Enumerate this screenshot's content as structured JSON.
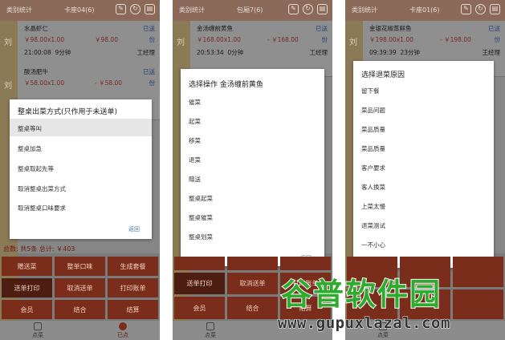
{
  "screens": [
    {
      "header": {
        "left": "类别统计",
        "center": "卡座04(6)"
      },
      "side_labels": [
        "刘",
        "刘"
      ],
      "items": [
        {
          "name": "水晶虾仁",
          "price": "￥98.00x1.00",
          "total": "￥98.00",
          "status": "已送",
          "unit": "份",
          "time": "21:00:08",
          "duration": "9分钟",
          "chef": "工经理"
        },
        {
          "name": "酸汤肥牛",
          "price": "￥58.00x1.00",
          "total": "- ￥58.00",
          "status": "已送",
          "unit": "份",
          "time": "",
          "duration": "",
          "chef": ""
        }
      ],
      "dialog": {
        "title": "整桌出菜方式(只作用于未送单)",
        "options": [
          "整桌等叫",
          "整桌加急",
          "整桌取起先等",
          "取消整桌出菜方式",
          "取消整桌口味要求"
        ],
        "back": "返回"
      },
      "summary": "总数: 共5条  总计: ￥403",
      "buttons": [
        "赠送菜",
        "整单口味",
        "生成套餐",
        "送单打印",
        "取消送单",
        "打印账单",
        "会员",
        "结合",
        "结算"
      ],
      "nav": [
        "点菜",
        "已点"
      ]
    },
    {
      "header": {
        "left": "类别统计",
        "center": "包厢7(6)"
      },
      "side_labels": [
        "刘"
      ],
      "items": [
        {
          "name": "金汤缠前黄鱼",
          "price": "￥168.00x1.00",
          "total": "- ￥168.00",
          "status": "已送",
          "unit": "份",
          "time": "20:53:34",
          "duration": "0分钟",
          "chef": "工经理"
        }
      ],
      "dialog": {
        "title": "选择操作  金汤缠前黄鱼",
        "options": [
          "催菜",
          "起菜",
          "移菜",
          "退菜",
          "赠送",
          "整桌起菜",
          "整桌催菜",
          "整桌划菜"
        ],
        "back": "返回"
      },
      "buttons": [
        "",
        "",
        "",
        "送单打印",
        "取消送单",
        "打印账单",
        "会员",
        "结合",
        "结算"
      ],
      "nav": [
        "点菜",
        "已点"
      ]
    },
    {
      "header": {
        "left": "类别统计",
        "center": "卡座01(6)"
      },
      "side_labels": [
        "刘"
      ],
      "items": [
        {
          "name": "金银花椒蒸鲜鱼",
          "price": "￥198.00x1.00",
          "total": "- ￥198.00",
          "status": "已送",
          "unit": "份",
          "time": "09:39:39",
          "duration": "23分钟",
          "chef": "王经理"
        }
      ],
      "dialog": {
        "title": "选择退菜原因",
        "options": [
          "留下餐",
          "菜品问题",
          "菜品质量",
          "菜品质量",
          "客户要求",
          "客人换菜",
          "上菜太慢",
          "退菜测试",
          "一不小心"
        ],
        "back": "取消"
      },
      "nav": [
        "点菜",
        "已点"
      ]
    }
  ],
  "watermark": {
    "brand": "谷普软件园",
    "url": "www.gupuxlazal.com"
  },
  "colors": {
    "header": "#8c6a5a",
    "button": "#7a2d1a",
    "accent_green": "#2eaa2e",
    "link": "#4a7ab0"
  }
}
